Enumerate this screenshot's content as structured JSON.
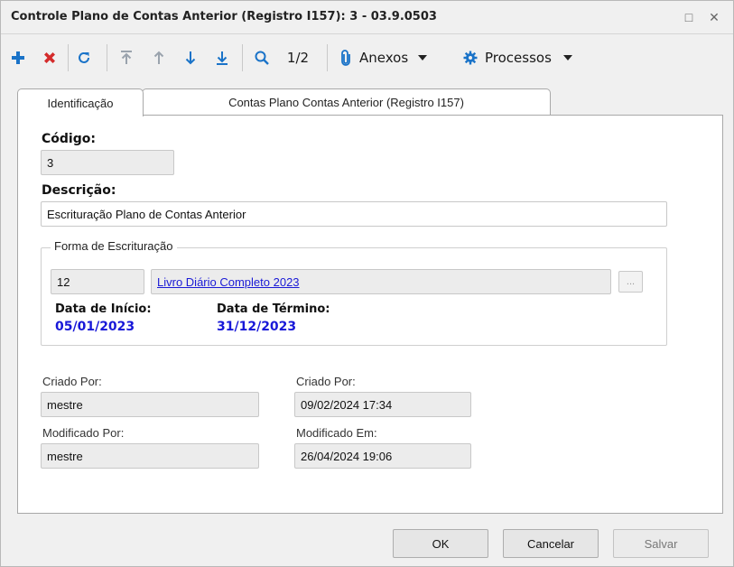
{
  "window": {
    "title": "Controle Plano de Contas Anterior (Registro I157): 3 - 03.9.0503",
    "maximize_glyph": "□",
    "close_glyph": "✕"
  },
  "toolbar": {
    "icons": [
      "add-icon",
      "delete-icon",
      "refresh-icon",
      "first-record-icon",
      "previous-record-icon",
      "next-record-icon",
      "last-record-icon",
      "search-icon"
    ],
    "page_indicator": "1/2",
    "attachments_label": "Anexos",
    "processes_label": "Processos",
    "colors": {
      "add": "#1a73c8",
      "delete": "#d42b2b",
      "icon": "#1a73c8"
    }
  },
  "tabs": [
    {
      "label": "Identificação",
      "active": true
    },
    {
      "label": "Contas Plano Contas Anterior (Registro I157)",
      "active": false
    }
  ],
  "form": {
    "codigo_label": "Código:",
    "codigo_value": "3",
    "descricao_label": "Descrição:",
    "descricao_value": "Escrituração Plano de Contas Anterior",
    "forma_group_label": "Forma de Escrituração",
    "forma_code": "12",
    "forma_link": "Livro Diário Completo 2023",
    "lookup_button": "...",
    "data_inicio_label": "Data de Início:",
    "data_inicio_value": "05/01/2023",
    "data_termino_label": "Data de Término:",
    "data_termino_value": "31/12/2023",
    "date_color": "#1818d8"
  },
  "audit": {
    "criado_por_label": "Criado Por:",
    "criado_por_value": "mestre",
    "criado_em_label": "Criado Por:",
    "criado_em_value": "09/02/2024 17:34",
    "modificado_por_label": "Modificado Por:",
    "modificado_por_value": "mestre",
    "modificado_em_label": "Modificado Em:",
    "modificado_em_value": "26/04/2024 19:06"
  },
  "buttons": {
    "ok": "OK",
    "cancel": "Cancelar",
    "save": "Salvar"
  }
}
